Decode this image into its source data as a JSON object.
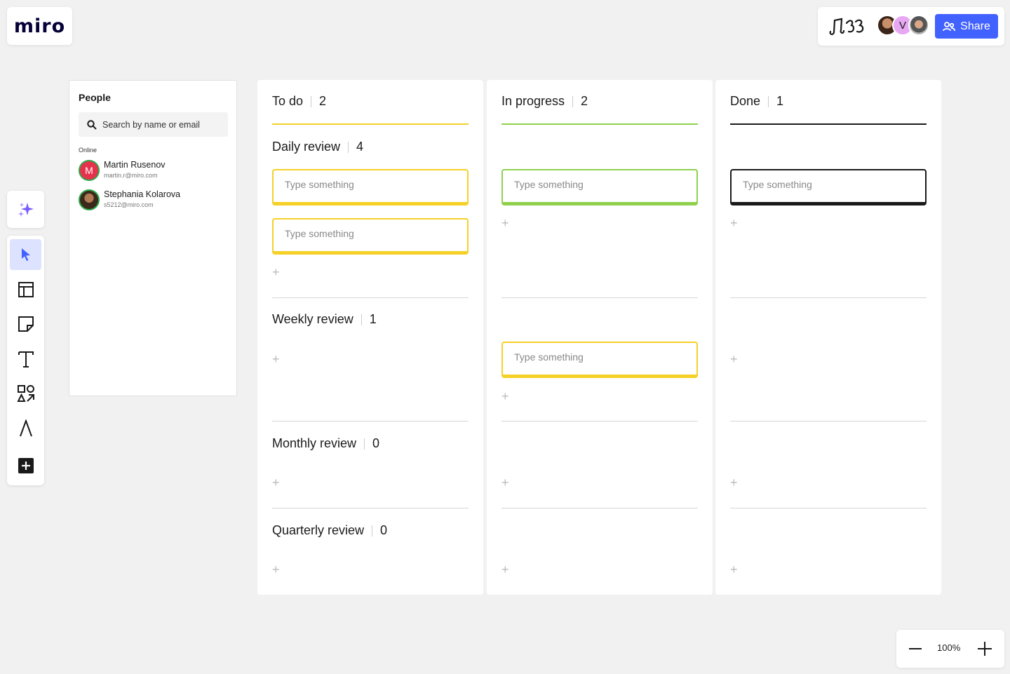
{
  "app": {
    "logo": "miro"
  },
  "topbar": {
    "share_label": "Share",
    "avatars": [
      {
        "icon": "user-photo-avatar"
      },
      {
        "initial": "V",
        "color": "#e8a7f2"
      },
      {
        "icon": "user-photo-avatar"
      }
    ]
  },
  "people_panel": {
    "title": "People",
    "search_placeholder": "Search by name or email",
    "online_label": "Online",
    "people": [
      {
        "name": "Martin Rusenov",
        "email": "martin.r@miro.com",
        "initial": "M"
      },
      {
        "name": "Stephania Kolarova",
        "email": "s5212@miro.com"
      }
    ]
  },
  "toolbar": {
    "tools": [
      "select-icon",
      "templates-icon",
      "sticky-note-icon",
      "text-icon",
      "shapes-icon",
      "pen-icon",
      "add-icon"
    ]
  },
  "board": {
    "card_placeholder": "Type something",
    "columns": [
      {
        "title": "To do",
        "count": "2",
        "color": "#f5d128"
      },
      {
        "title": "In progress",
        "count": "2",
        "color": "#8fd14f"
      },
      {
        "title": "Done",
        "count": "1",
        "color": "#1a1a1a"
      }
    ],
    "rows": [
      {
        "title": "Daily review",
        "count": "4"
      },
      {
        "title": "Weekly review",
        "count": "1"
      },
      {
        "title": "Monthly review",
        "count": "0"
      },
      {
        "title": "Quarterly review",
        "count": "0"
      }
    ],
    "plus_symbol": "+"
  },
  "zoom": {
    "level": "100%"
  },
  "colors": {
    "accent": "#4262ff",
    "yellow": "#f5d128",
    "green": "#8fd14f",
    "black": "#1a1a1a"
  }
}
